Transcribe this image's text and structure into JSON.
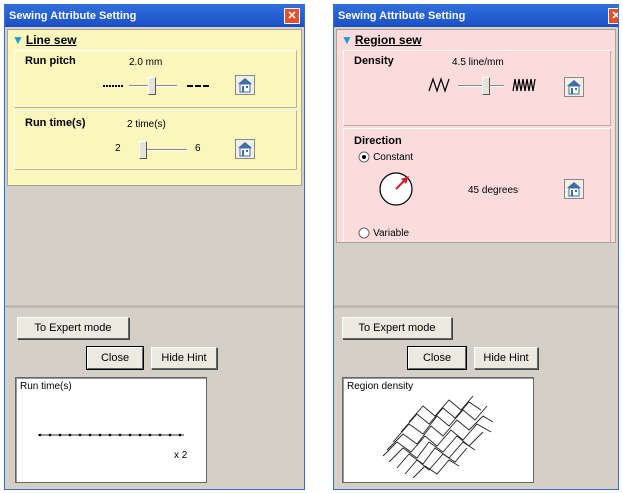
{
  "left_window": {
    "title": "Sewing Attribute Setting",
    "close_glyph": "✕",
    "section_label": "Line sew",
    "run_pitch": {
      "label": "Run pitch",
      "value": "2.0 mm"
    },
    "run_times": {
      "label": "Run time(s)",
      "value": "2 time(s)",
      "min": "2",
      "max": "6"
    },
    "expert_button": "To Expert mode",
    "close_button": "Close",
    "hide_hint_button": "Hide Hint",
    "hint": {
      "label": "Run time(s)",
      "caption": "x 2"
    }
  },
  "right_window": {
    "title": "Sewing Attribute Setting",
    "close_glyph": "✕",
    "section_label": "Region sew",
    "density": {
      "label": "Density",
      "value": "4.5 line/mm"
    },
    "direction": {
      "label": "Direction",
      "option_constant": "Constant",
      "option_variable": "Variable",
      "selected": "Constant",
      "angle_text": "45 degrees"
    },
    "expert_button": "To Expert mode",
    "close_button": "Close",
    "hide_hint_button": "Hide Hint",
    "hint": {
      "label": "Region density"
    }
  },
  "colors": {
    "line_sew_panel": "#fbf6be",
    "region_sew_panel": "#fbdcdc",
    "title_bar": "#1b4fc2",
    "dialog_face": "#d4d0c8"
  },
  "icons": [
    "close-icon",
    "expand-triangle-icon",
    "house-reset-icon",
    "short-stitch-icon",
    "long-stitch-icon",
    "sparse-zigzag-icon",
    "dense-zigzag-icon",
    "direction-dial-icon"
  ]
}
